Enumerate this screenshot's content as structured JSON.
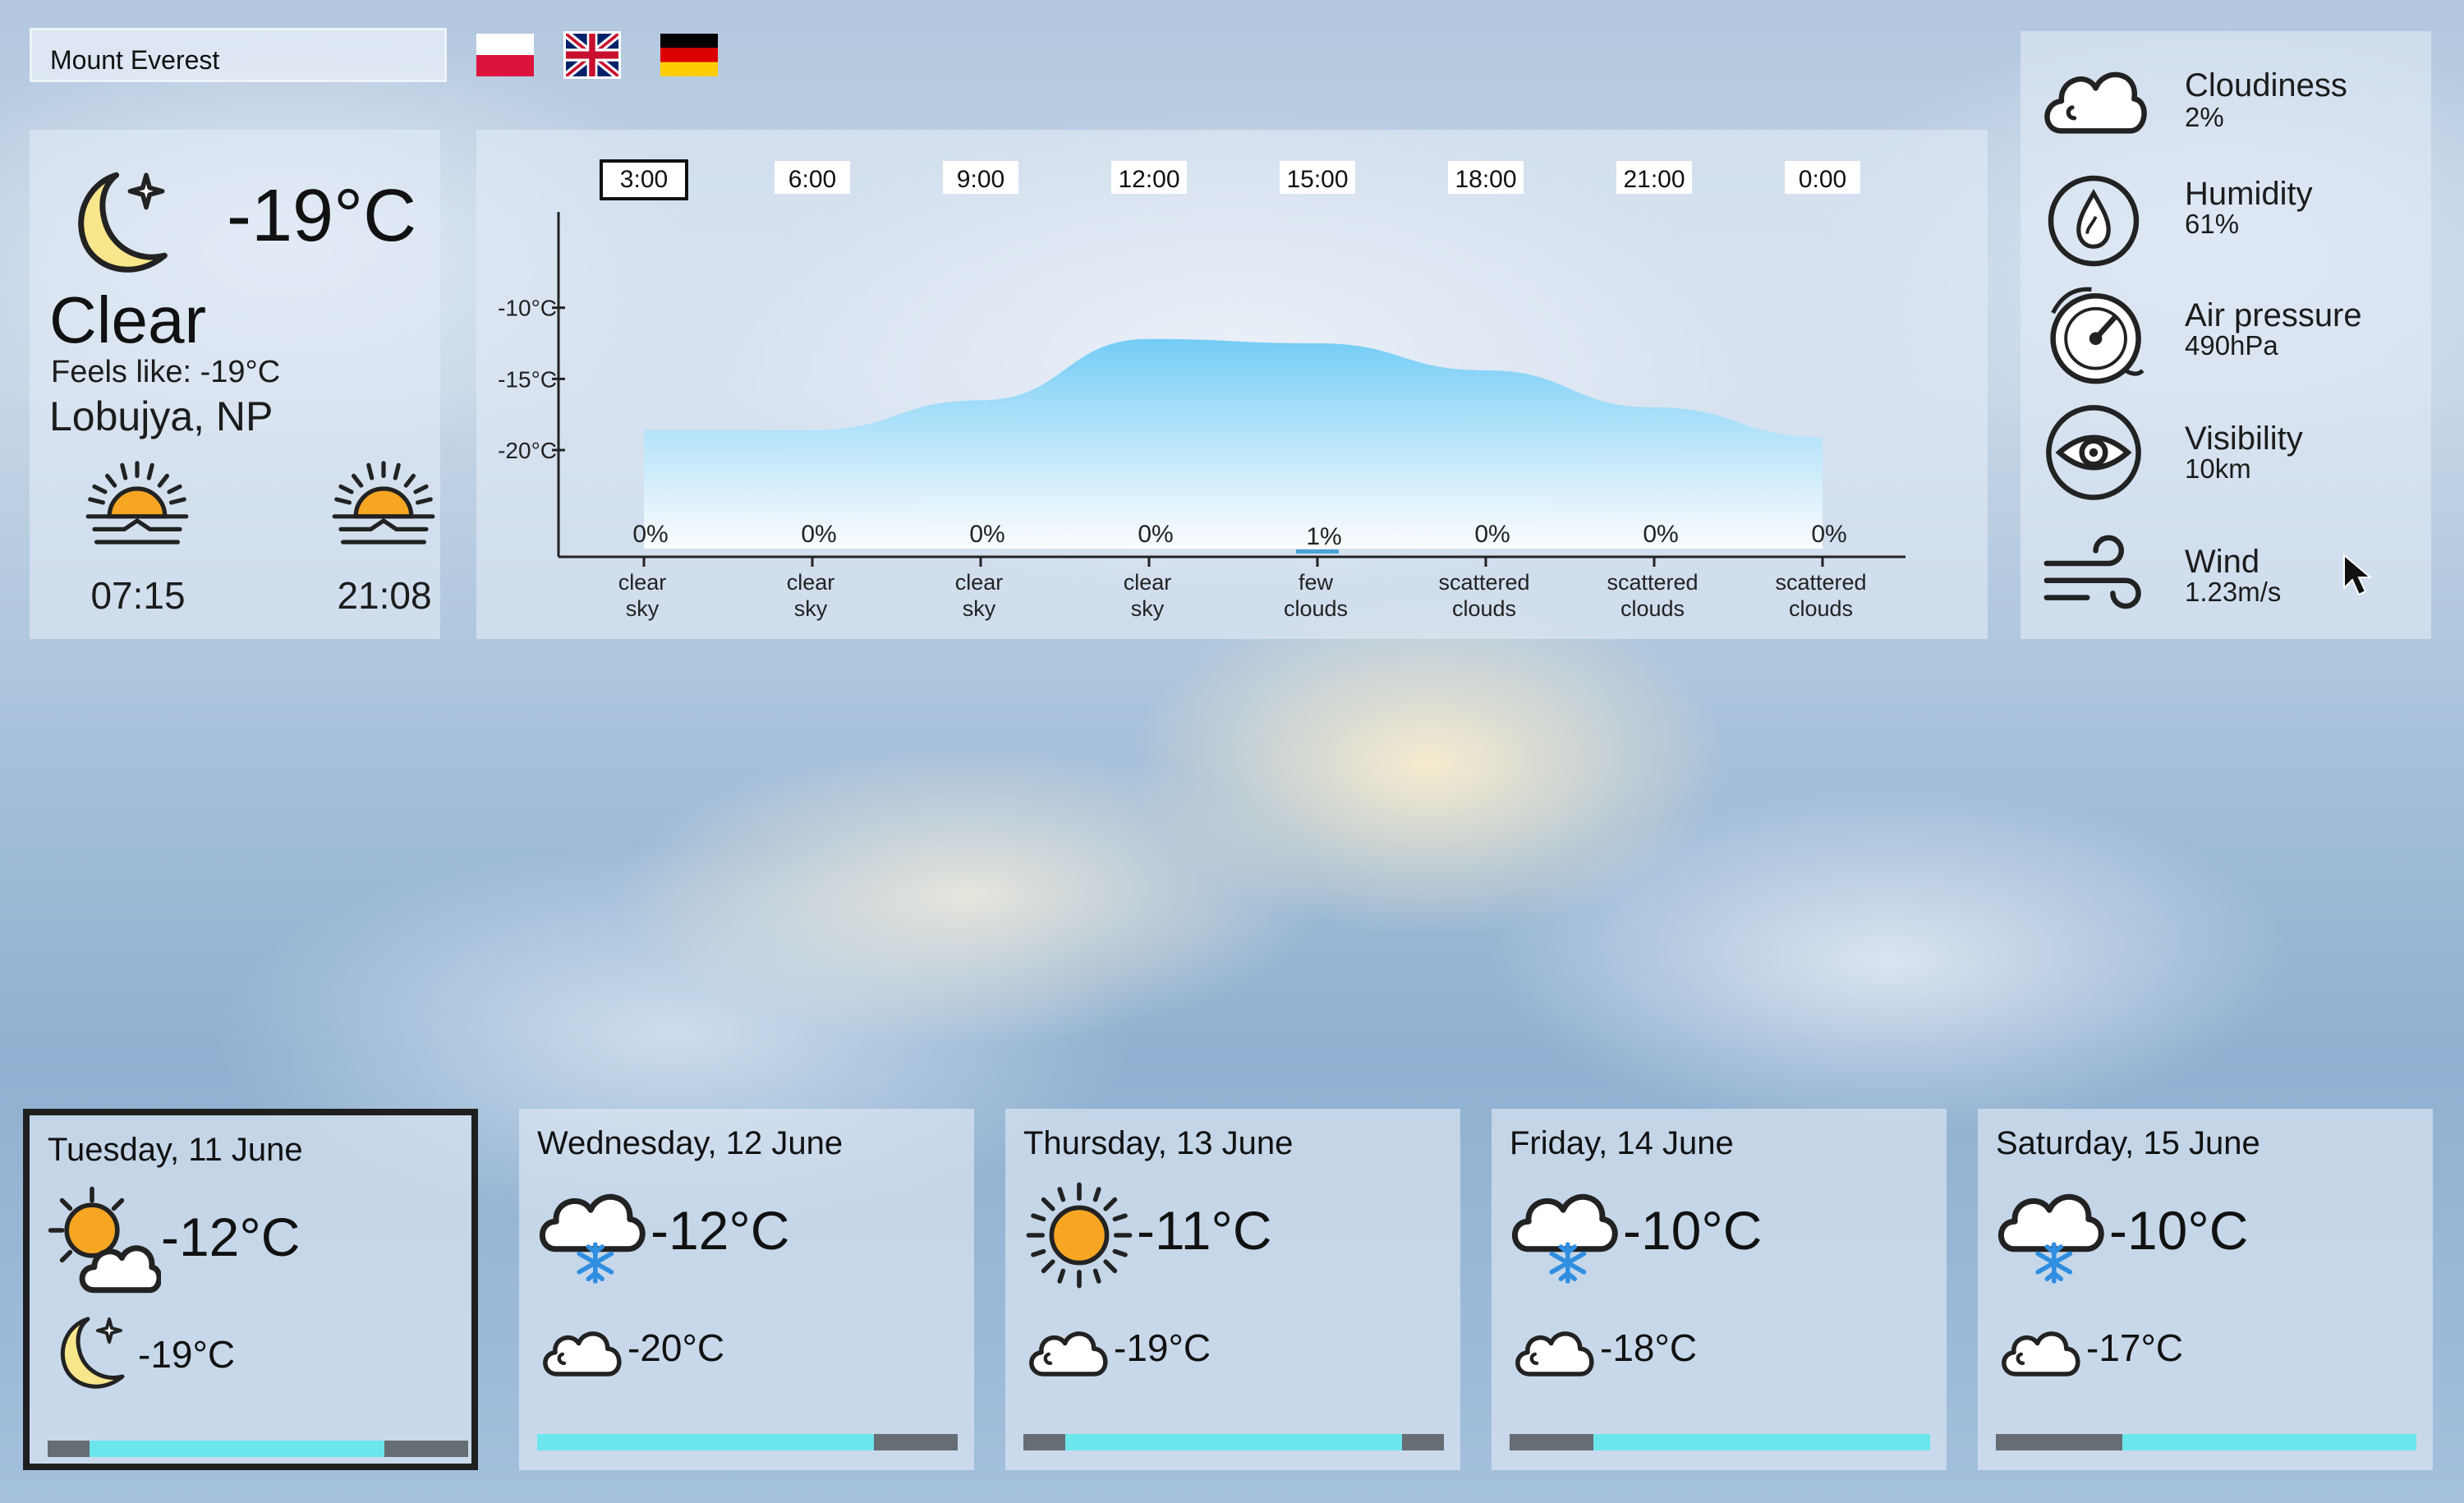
{
  "search": {
    "value": "Mount Everest"
  },
  "languages": [
    {
      "code": "pl",
      "selected": false
    },
    {
      "code": "en",
      "selected": true
    },
    {
      "code": "de",
      "selected": false
    }
  ],
  "current": {
    "icon": "moon-star-icon",
    "temp": "-19°C",
    "condition": "Clear",
    "feels_like": "Feels like: -19°C",
    "location": "Lobujya, NP",
    "sunrise": "07:15",
    "sunset": "21:08"
  },
  "chart_data": {
    "type": "area",
    "x": [
      "3:00",
      "6:00",
      "9:00",
      "12:00",
      "15:00",
      "18:00",
      "21:00",
      "0:00"
    ],
    "selected_x": "3:00",
    "series": [
      {
        "values": [
          -18.6,
          -18.6,
          -16.5,
          -12.2,
          -12.5,
          -14.4,
          -17.0,
          -19.1
        ]
      }
    ],
    "precipitation_labels": [
      "0%",
      "0%",
      "0%",
      "0%",
      "1%",
      "0%",
      "0%",
      "0%"
    ],
    "precipitation": [
      0,
      0,
      0,
      0,
      1,
      0,
      0,
      0
    ],
    "conditions": [
      [
        "clear",
        "sky"
      ],
      [
        "clear",
        "sky"
      ],
      [
        "clear",
        "sky"
      ],
      [
        "clear",
        "sky"
      ],
      [
        "few",
        "clouds"
      ],
      [
        "scattered",
        "clouds"
      ],
      [
        "scattered",
        "clouds"
      ],
      [
        "scattered",
        "clouds"
      ]
    ],
    "ytick_labels": [
      "-10°C",
      "-15°C",
      "-20°C"
    ],
    "yticks": [
      -10,
      -15,
      -20
    ],
    "ylim": [
      -27.5,
      -5
    ],
    "colors": {
      "area_top": "#73ccf6",
      "area_bottom": "#ffffff",
      "precip": "#4aa3d3"
    }
  },
  "details": [
    {
      "icon": "cloud-icon",
      "label": "Cloudiness",
      "value": "2%"
    },
    {
      "icon": "humidity-icon",
      "label": "Humidity",
      "value": "61%"
    },
    {
      "icon": "gauge-icon",
      "label": "Air pressure",
      "value": "490hPa"
    },
    {
      "icon": "eye-icon",
      "label": "Visibility",
      "value": "10km"
    },
    {
      "icon": "wind-icon",
      "label": "Wind",
      "value": "1.23m/s"
    }
  ],
  "forecast": [
    {
      "date": "Tuesday, 11 June",
      "day_icon": "sun-cloud-icon",
      "max": "-12°C",
      "night_icon": "moon-star-icon",
      "min": "-19°C",
      "range": [
        0.1,
        0.8
      ],
      "selected": true
    },
    {
      "date": "Wednesday, 12 June",
      "day_icon": "snow-cloud-icon",
      "max": "-12°C",
      "night_icon": "cloud-icon",
      "min": "-20°C",
      "range": [
        0.0,
        0.8
      ],
      "selected": false
    },
    {
      "date": "Thursday, 13 June",
      "day_icon": "sun-icon",
      "max": "-11°C",
      "night_icon": "cloud-icon",
      "min": "-19°C",
      "range": [
        0.1,
        0.9
      ],
      "selected": false
    },
    {
      "date": "Friday, 14 June",
      "day_icon": "snow-cloud-icon",
      "max": "-10°C",
      "night_icon": "cloud-icon",
      "min": "-18°C",
      "range": [
        0.2,
        1.0
      ],
      "selected": false
    },
    {
      "date": "Saturday, 15 June",
      "day_icon": "snow-cloud-icon",
      "max": "-10°C",
      "night_icon": "cloud-icon",
      "min": "-17°C",
      "range": [
        0.3,
        1.0
      ],
      "selected": false
    }
  ]
}
